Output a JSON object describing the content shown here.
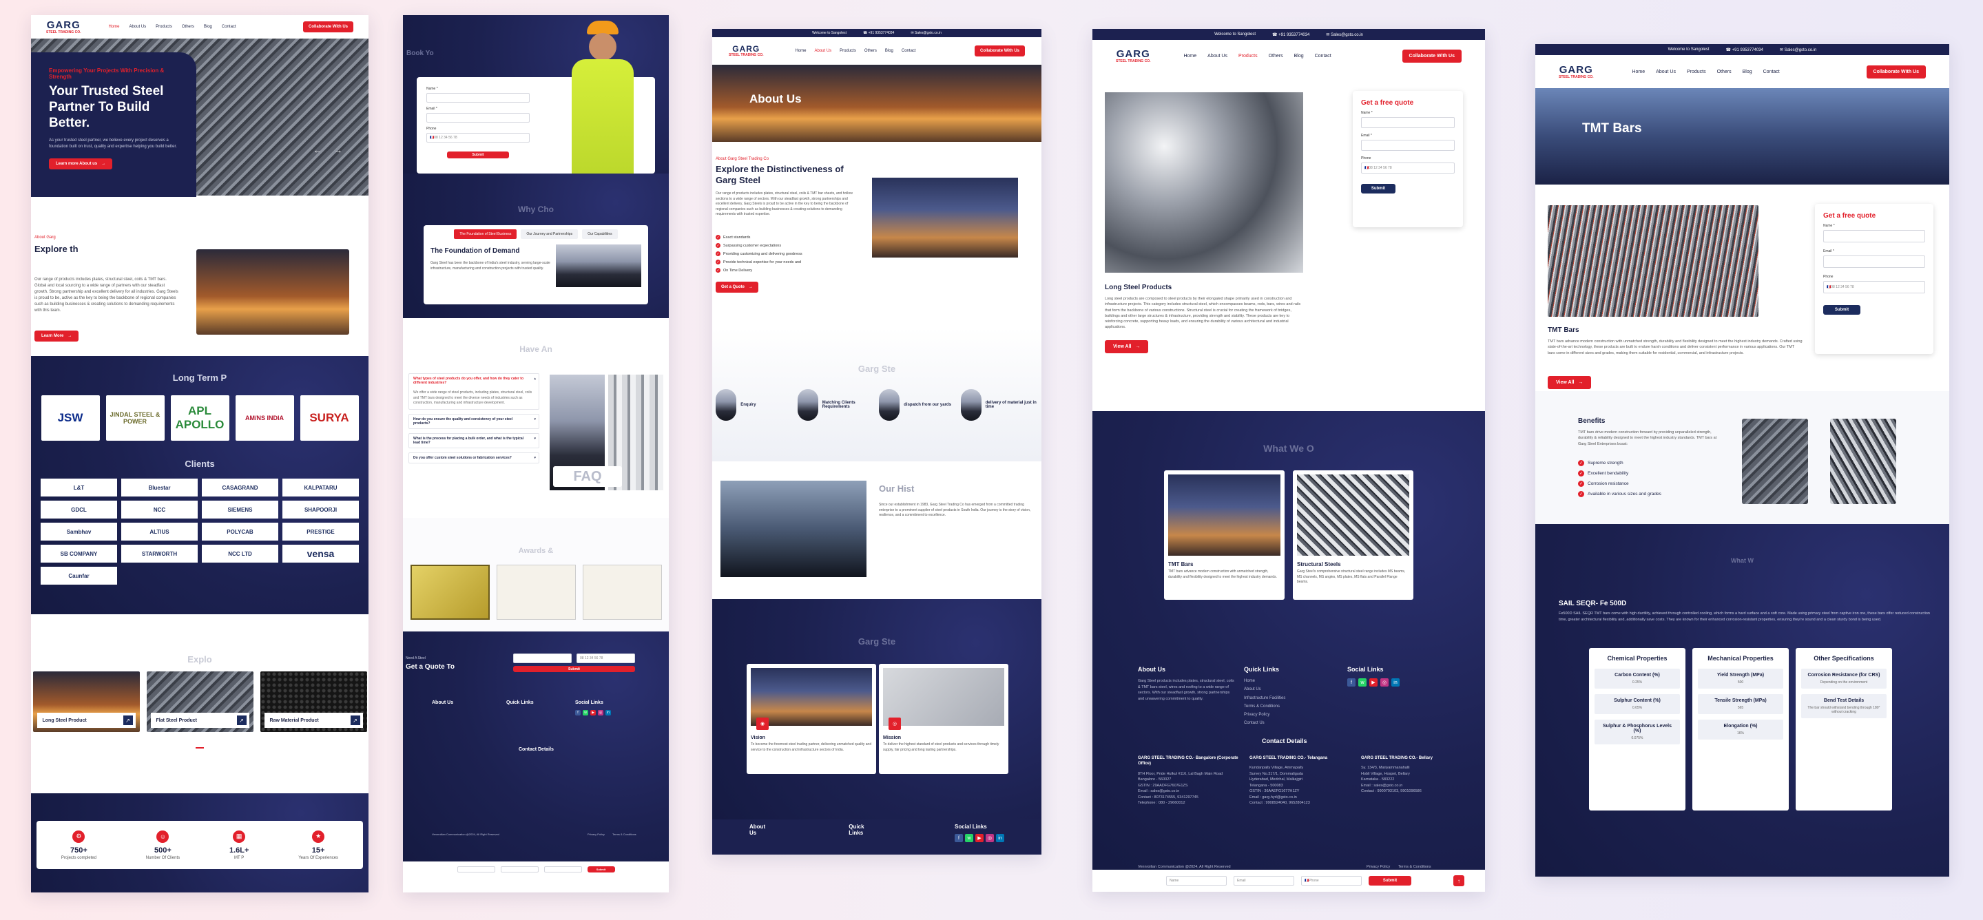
{
  "shared": {
    "logo": "GARG",
    "logo_sub": "STEEL TRADING CO.",
    "welcome": "Welcome to Sangolest",
    "phone": "+91 9353774034",
    "email": "Sales@gsto.co.in",
    "nav": [
      "Home",
      "About Us",
      "Products",
      "Others",
      "Blog",
      "Contact"
    ],
    "cta": "Collaborate With Us"
  },
  "p1": {
    "hero_kicker": "Empowering Your Projects With Precision & Strength",
    "hero_title": "Your Trusted Steel Partner To Build Better.",
    "hero_text": "As your trusted steel partner, we believe every project deserves a foundation built on trust, quality and expertise helping you build better.",
    "hero_btn": "Learn more About us",
    "about_kicker": "About Garg",
    "about_title": "Explore th",
    "about_text": "Our range of products includes plates, structural steel, coils & TMT bars. Global and local sourcing to a wide range of partners with our steadfast growth. Strong partnership and excellent delivery for all industries. Garg Steels is proud to be, active as the key to being the backbone of regional companies such as building businesses & creating solutions to demanding requirements with this team.",
    "learn_more": "Learn More",
    "partners_title": "Long Term P",
    "partners": [
      "JSW",
      "JINDAL STEEL & POWER",
      "APL APOLLO",
      "AM/NS INDIA",
      "SURYA"
    ],
    "clients_title": "Clients",
    "clients": [
      "L&T",
      "Bluestar",
      "CASAGRAND",
      "KALPATARU",
      "GDCL",
      "NCC",
      "SIEMENS",
      "SHAPOORJI",
      "Sambhav",
      "ALTIUS",
      "POLYCAB",
      "PRESTIGE",
      "SB COMPANY",
      "STARWORTH",
      "NCC LTD",
      "vensa",
      "Caunfar"
    ],
    "explore_title": "Explo",
    "products": [
      "Long Steel Product",
      "Flat Steel Product",
      "Raw Material Product"
    ],
    "stats": [
      {
        "num": "750+",
        "label": "Projects completed"
      },
      {
        "num": "500+",
        "label": "Number Of Clients"
      },
      {
        "num": "1.6L+",
        "label": "MT P"
      },
      {
        "num": "15+",
        "label": "Years Of Experiences"
      }
    ]
  },
  "p2": {
    "book_title": "Book Yo",
    "fields": [
      "Name *",
      "Email *",
      "Phone"
    ],
    "phone_ph": "08 12 34 56 78",
    "submit": "Submit",
    "why_title": "Why Cho",
    "tabs": [
      "The Foundation of Steel Business",
      "Our Journey and Partnerships",
      "Our Capabilities"
    ],
    "foundation_title": "The Foundation of Demand",
    "foundation_text": "Garg Steel has been the backbone of India's steel industry, serving large-scale infrastructure, manufacturing and construction projects with trusted quality.",
    "faq_title": "Have An",
    "faqs": [
      "What types of steel products do you offer, and how do they cater to different industries?",
      "How do you ensure the quality and consistency of your steel products?",
      "What is the process for placing a bulk order, and what is the typical lead time?",
      "Do you offer custom steel solutions or fabrication services?"
    ],
    "faq_answer": "We offer a wide range of steel products, including plates, structural steel, coils and TMT bars designed to meet the diverse needs of industries such as construction, manufacturing and infrastructure development.",
    "faq_badge": "FAQ",
    "awards_title": "Awards &",
    "quote_kicker": "Need A Steel",
    "quote_title": "Get a Quote To",
    "footer": {
      "about": "About Us",
      "quick": "Quick Links",
      "social": "Social Links",
      "contact": "Contact Details",
      "copyright": "Vennroilian Communication @2024, All Right Reserved",
      "privacy": "Privacy Policy",
      "terms": "Terms & Conditions"
    }
  },
  "p3": {
    "hero_title": "About Us",
    "kicker": "About Garg Steel Trading Co",
    "title": "Explore the Distinctiveness of Garg Steel",
    "text": "Our range of products includes plates, structural steel, coils & TMT bar sheets, and hollow sections to a wide range of sectors. With our steadfast growth, strong partnerships and excellent delivery, Garg Steels is proud to be active in the key to being the backbone of regional companies such as building businesses & creating solutions to demanding requirements with trusted expertise.",
    "points": [
      "Exact standards",
      "Surpassing customer expectations",
      "Providing customizing and delivering goodness",
      "Provide technical expertise for your needs and",
      "On Time Delivery"
    ],
    "quote_btn": "Get a Quote",
    "steps_title": "Garg Ste",
    "steps": [
      "Enquiry",
      "Matching Clients Requirements",
      "dispatch from our yards",
      "delivery of material just in time"
    ],
    "history_title": "Our Hist",
    "history_text": "Since our establishment in 1983, Garg Steel Trading Co has emerged from a committed trading enterprise to a prominent supplier of steel products in South India. Our journey is the story of vision, resilience, and a commitment to excellence.",
    "mv_title": "Garg Ste",
    "vision": "Vision",
    "vision_text": "To become the foremost steel trading partner, delivering unmatched quality and service to the construction and infrastructure sectors of India.",
    "mission": "Mission",
    "mission_text": "To deliver the highest standard of steel products and services through timely supply, fair pricing and long lasting partnerships.",
    "footer_about": "About Us",
    "footer_quick": "Quick Links",
    "footer_social": "Social Links"
  },
  "p4": {
    "quote_title": "Get a free quote",
    "fields": [
      "Name *",
      "Email *",
      "Phone"
    ],
    "phone_ph": "08 12 34 56 78",
    "submit": "Submit",
    "product_title": "Long Steel Products",
    "product_text": "Long steel products are composed to steel products by their elongated shape primarily used in construction and infrastructure projects. This category includes structural steel, which encompasses beams, rods, bars, wires and rails that form the backbone of various constructions. Structural steel is crucial for creating the framework of bridges, buildings and other large structures & infrastructure, providing strength and stability. These products are key to reinforcing concrete, supporting heavy loads, and ensuring the durability of various architectural and industrial applications.",
    "view_all": "View All",
    "what_title": "What We O",
    "cards": [
      {
        "title": "TMT Bars",
        "text": "TMT bars advance modern construction with unmatched strength, durability and flexibility designed to meet the highest industry demands."
      },
      {
        "title": "Structural Steels",
        "text": "Garg Steel's comprehensive structural steel range includes MS beams, MS channels, MS angles, MS plates, MS flats and Parallel Flange beams."
      }
    ],
    "footer": {
      "about": "About Us",
      "about_text": "Garg Steel products includes plates, structural steel, coils & TMT bars steel, wires and roofing to a wide range of sectors. With our steadfast growth, strong partnerships and unwavering commitment to quality.",
      "quick": "Quick Links",
      "links": [
        "Home",
        "About Us",
        "Infrastructure Facilities",
        "Terms & Conditions",
        "Privacy Policy",
        "Contact Us"
      ],
      "social": "Social Links",
      "contact": "Contact Details",
      "offices": [
        {
          "name": "GARG STEEL TRADING CO.- Bangalore (Corporate Office)",
          "lines": [
            "8TH Floor, Pride Hulkul #116, Lal Bagh Main Road Bangalore - 560027",
            "GSTIN : 29AADFG7607E1ZS",
            "Email : sales@gsto.co.in",
            "Contact : 8073174555, 9341297745",
            "Telephone : 080 - 29660012"
          ]
        },
        {
          "name": "GARG STEEL TRADING CO.- Telangana",
          "lines": [
            "Kundanpally Village, Ammapally",
            "Survey No.317/1, Dommaliguda",
            "Hyderabad, Medchal, Malkajgiri",
            "Telangana - 500083",
            "GSTIN : 36AAEFG1677H1ZY",
            "Email : garg.hyd@gsto.co.in",
            "Contact : 9908924040, 9652804123"
          ]
        },
        {
          "name": "GARG STEEL TRADING CO.- Bellary",
          "lines": [
            "Sy. 134/3, Mariyammanahalli",
            "Hobli Village, Hospet, Bellary",
            "Karnataka - 583222",
            "Email : sales@gsto.co.in",
            "Contact : 9900793103, 9901096586"
          ]
        }
      ],
      "copyright": "Vennroilian Communication @2024, All Right Reserved",
      "privacy": "Privacy Policy",
      "terms": "Terms & Conditions",
      "bar_fields": [
        "Name",
        "Email",
        "Phone"
      ],
      "bar_submit": "Submit"
    }
  },
  "p5": {
    "hero_title": "TMT Bars",
    "quote_title": "Get a free quote",
    "fields": [
      "Name *",
      "Email *",
      "Phone"
    ],
    "phone_ph": "08 12 34 56 78",
    "submit": "Submit",
    "product_title": "TMT Bars",
    "product_text": "TMT bars advance modern construction with unmatched strength, durability and flexibility designed to meet the highest industry demands. Crafted using state-of-the-art technology, these products are built to endure harsh conditions and deliver consistent performance in various applications. Our TMT bars come in different sizes and grades, making them suitable for residential, commercial, and infrastructure projects.",
    "view_all": "View All",
    "benefits_title": "Benefits",
    "benefits_text": "TMT bars drive modern construction forward by providing unparalleled strength, durability & reliability designed to meet the highest industry standards. TMT bars at Garg Steel Enterprises boast:",
    "benefits": [
      "Supreme strength",
      "Excellent bendability",
      "Corrosion resistance",
      "Available in various sizes and grades"
    ],
    "what_title": "What W",
    "sail_title": "SAIL SEQR- Fe 500D",
    "sail_text": "Fe500D SAIL SEQR TMT bars come with high ductility, achieved through controlled cooling, which forms a hard surface and a soft core. Made using primary steel from captive iron ore, these bars offer reduced construction time, greater architectural flexibility and, additionally save costs. They are known for their enhanced corrosion-resistant properties, ensuring they're sound and a clean sturdy bond is being used.",
    "spec_cols": [
      {
        "title": "Chemical Properties",
        "items": [
          {
            "name": "Carbon Content (%)",
            "val": "0.25%"
          },
          {
            "name": "Sulphur Content (%)",
            "val": "0.05%"
          },
          {
            "name": "Sulphur & Phosphorus Levels (%)",
            "val": "0.075%"
          }
        ]
      },
      {
        "title": "Mechanical Properties",
        "items": [
          {
            "name": "Yield Strength (MPa)",
            "val": "500"
          },
          {
            "name": "Tensile Strength (MPa)",
            "val": "565"
          },
          {
            "name": "Elongation (%)",
            "val": "16%"
          }
        ]
      },
      {
        "title": "Other Specifications",
        "items": [
          {
            "name": "Corrosion Resistance (for CRS)",
            "val": "Depending on the environment"
          },
          {
            "name": "Bend Test Details",
            "val": "The bar should withstand bending through 180° without cracking"
          }
        ]
      }
    ]
  }
}
